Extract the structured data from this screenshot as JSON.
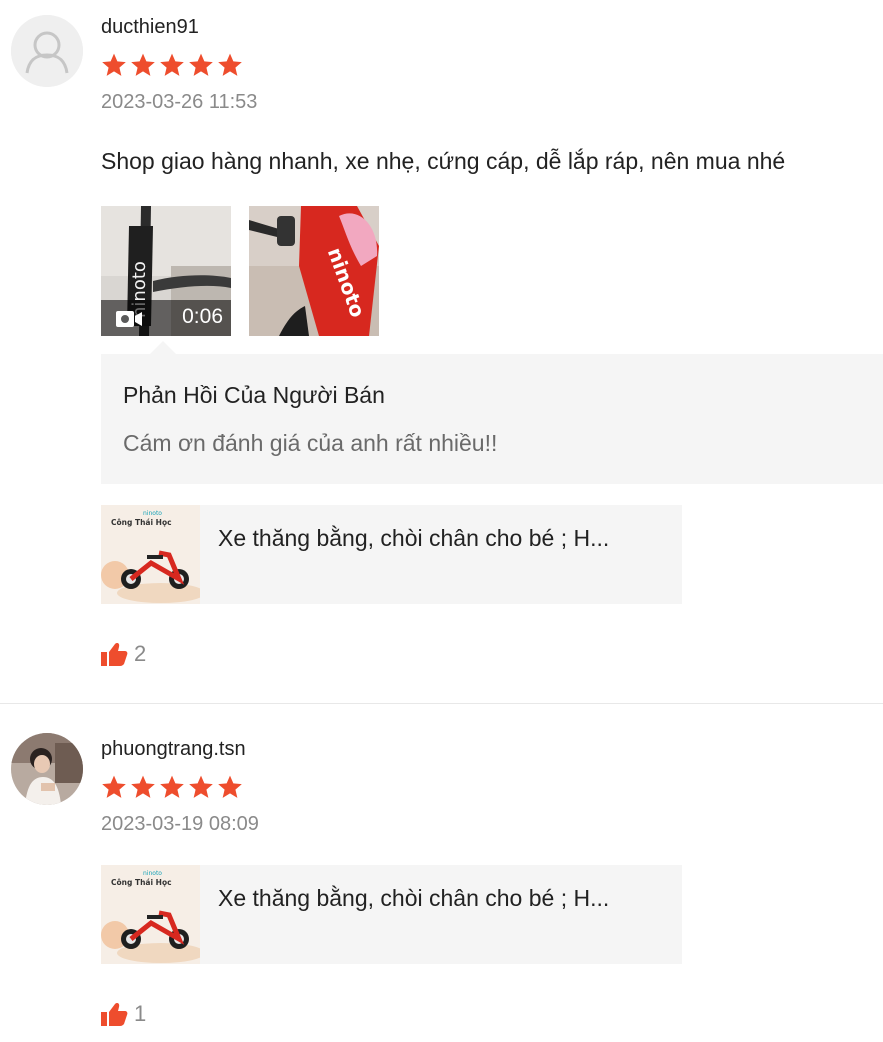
{
  "reviews": [
    {
      "username": "ducthien91",
      "rating": 5,
      "date": "2023-03-26 11:53",
      "comment": "Shop giao hàng nhanh, xe nhẹ, cứng cáp, dễ lắp ráp, nên mua nhé",
      "media": {
        "video_duration": "0:06",
        "video_thumb_text": "ninoto",
        "image_thumb_text": "ninoto"
      },
      "seller_reply": {
        "title": "Phản Hồi Của Người Bán",
        "text": "Cám ơn đánh giá của anh rất nhiều!!"
      },
      "product": {
        "name": "Xe thăng bằng, chòi chân cho bé ; H...",
        "thumb_brand": "ninoto",
        "thumb_heading": "Công Thái Học"
      },
      "likes": "2"
    },
    {
      "username": "phuongtrang.tsn",
      "rating": 5,
      "date": "2023-03-19 08:09",
      "product": {
        "name": "Xe thăng bằng, chòi chân cho bé ; H...",
        "thumb_brand": "ninoto",
        "thumb_heading": "Công Thái Học"
      },
      "likes": "1"
    }
  ],
  "icons": {
    "default_avatar": "user-silhouette-icon",
    "star": "star-icon",
    "video": "video-camera-icon",
    "like": "thumbs-up-icon"
  },
  "colors": {
    "star": "#ee4d2d",
    "like": "#ee4d2d",
    "muted_text": "#8a8a8a",
    "panel_bg": "#f5f5f5"
  }
}
